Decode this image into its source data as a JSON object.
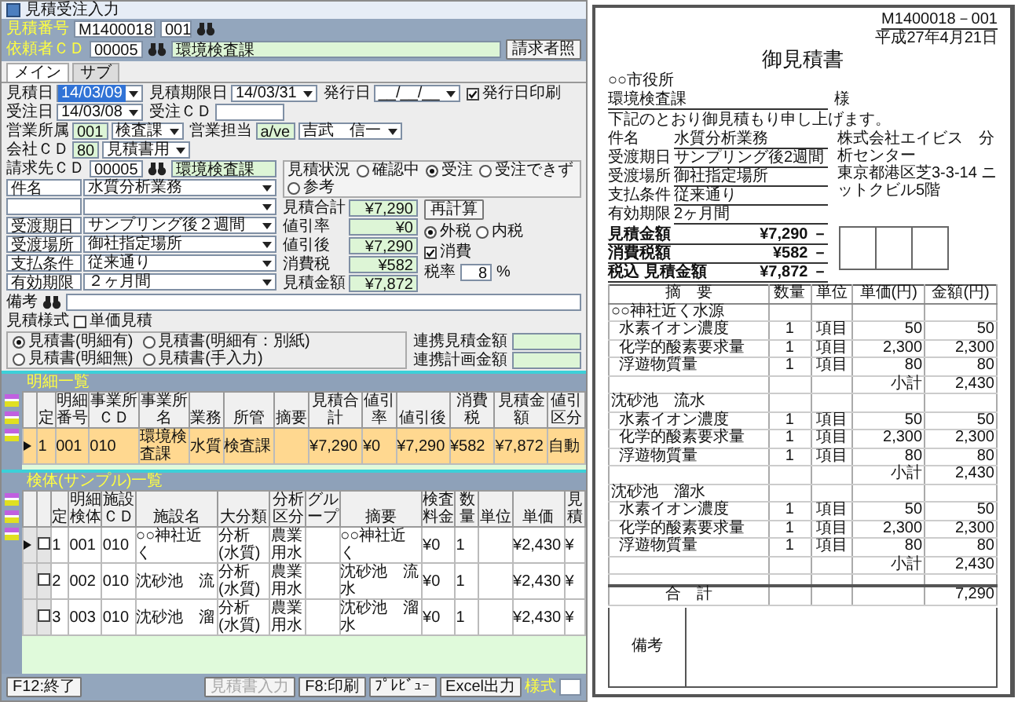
{
  "app": {
    "title": "見積受注入力"
  },
  "estimate_no": {
    "label": "見積番号",
    "value": "M1400018",
    "branch": "001"
  },
  "requester": {
    "label": "依頼者ＣＤ",
    "code": "00005",
    "name": "環境検査課",
    "button": "請求者照"
  },
  "tabs": [
    {
      "label": "メイン",
      "selected": true
    },
    {
      "label": "サブ",
      "selected": false
    }
  ],
  "date_row": [
    {
      "kind": "date",
      "label": "見積日",
      "value": "14/03/09",
      "highlighted": true
    },
    {
      "kind": "date",
      "label": "見積期限日",
      "value": "14/03/31",
      "highlighted": false
    },
    {
      "kind": "date",
      "label": "発行日",
      "value": "__/__/__",
      "highlighted": false
    },
    {
      "kind": "check",
      "label": "発行日印刷",
      "checked": true
    },
    {
      "kind": "date",
      "label": "受注日",
      "value": "14/03/08",
      "highlighted": false
    },
    {
      "kind": "text",
      "label": "受注ＣＤ"
    }
  ],
  "sales_row": [
    {
      "label": "営業所属",
      "code": "001",
      "name": "検査課"
    },
    {
      "label": "営業担当",
      "code": "a/ve",
      "name": "吉武　信一"
    },
    {
      "label": "会社ＣＤ",
      "code": "80",
      "name": "見積書用"
    }
  ],
  "billing": {
    "label": "請求先ＣＤ",
    "code": "00005",
    "name": "環境検査課"
  },
  "detail_fields": [
    {
      "kind": "field",
      "label": "件名",
      "value": "水質分析業務"
    },
    {
      "kind": "blank"
    },
    {
      "kind": "field",
      "label": "受渡期日",
      "value": "サンプリング後２週間"
    },
    {
      "kind": "field",
      "label": "受渡場所",
      "value": "御社指定場所"
    },
    {
      "kind": "field",
      "label": "支払条件",
      "value": "従来通り"
    },
    {
      "kind": "field",
      "label": "有効期限",
      "value": "２ヶ月間"
    }
  ],
  "status": {
    "label": "見積状況",
    "options": [
      {
        "label": "確認中",
        "selected": false
      },
      {
        "label": "受注",
        "selected": true
      },
      {
        "label": "受注できず",
        "selected": false
      },
      {
        "label": "参考",
        "selected": false
      }
    ]
  },
  "amounts": [
    {
      "label": "見積合計",
      "value": "¥7,290"
    },
    {
      "label": "値引率",
      "value": "¥0"
    },
    {
      "label": "値引後",
      "value": "¥7,290"
    },
    {
      "label": "消費税",
      "value": "¥582"
    },
    {
      "label": "見積金額",
      "value": "¥7,872"
    }
  ],
  "recalc_button": "再計算",
  "tax_mode": [
    {
      "label": "外税",
      "selected": true
    },
    {
      "label": "内税",
      "selected": false
    }
  ],
  "tax_check": {
    "label": "消費",
    "checked": true
  },
  "tax_rate": {
    "label": "税率",
    "value": "8",
    "unit": "%"
  },
  "remarks": {
    "label": "備考"
  },
  "format_check": {
    "label": "見積様式",
    "option": "単価見積",
    "checked": false
  },
  "format_options": [
    {
      "label": "見積書(明細有)",
      "selected": true
    },
    {
      "label": "見積書(明細有：別紙)",
      "selected": false
    },
    {
      "label": "見積書(明細無)",
      "selected": false
    },
    {
      "label": "見積書(手入力)",
      "selected": false
    }
  ],
  "linked": [
    {
      "label": "連携見積金額"
    },
    {
      "label": "連携計画金額"
    }
  ],
  "detail_table": {
    "title": "明細一覧",
    "columns": [
      "定",
      "明細番号",
      "事業所ＣＤ",
      "事業所名",
      "業務",
      "所管",
      "摘要",
      "見積合計",
      "値引率",
      "値引後",
      "消費税",
      "見積金額",
      "値引区分"
    ],
    "rows": [
      {
        "selected": true,
        "current": true,
        "cells": [
          "1",
          "001",
          "010",
          "環境検査課",
          "水質",
          "検査課",
          null,
          "¥7,290",
          "¥0",
          "¥7,290",
          "¥582",
          "¥7,872",
          "自動"
        ]
      }
    ]
  },
  "sample_table": {
    "title": "検体(サンプル)一覧",
    "columns": [
      "定",
      "明細検体",
      "施設ＣＤ",
      "施設名",
      "大分類",
      "分析区分",
      "グループ",
      "摘要",
      "検査料金",
      "数量",
      "単位",
      "単価",
      "見積"
    ],
    "rows": [
      {
        "current": true,
        "checked": false,
        "cells": [
          "1",
          "001",
          "010",
          "○○神社近く",
          "分析(水質)",
          "農業用水",
          null,
          "○○神社近く",
          "¥0",
          "1",
          null,
          "¥2,430",
          "¥"
        ]
      },
      {
        "current": false,
        "checked": false,
        "cells": [
          "2",
          "002",
          "010",
          "沈砂池　流",
          "分析(水質)",
          "農業用水",
          null,
          "沈砂池　流水",
          "¥0",
          "1",
          null,
          "¥2,430",
          "¥"
        ]
      },
      {
        "current": false,
        "checked": false,
        "cells": [
          "3",
          "003",
          "010",
          "沈砂池　溜",
          "分析(水質)",
          "農業用水",
          null,
          "沈砂池　溜水",
          "¥0",
          "1",
          null,
          "¥2,430",
          "¥"
        ]
      }
    ]
  },
  "exit_button": {
    "label": "F12:終了",
    "disabled": false
  },
  "buttons": [
    {
      "label": "見積書入力",
      "disabled": true
    },
    {
      "label": "F8:印刷",
      "disabled": false
    },
    {
      "label": "ﾌﾟﾚﾋﾞｭｰ",
      "disabled": false
    },
    {
      "label": "Excel出力",
      "disabled": false
    }
  ],
  "style_field": {
    "label": "様式"
  },
  "document": {
    "number": "M1400018－001",
    "date": "平成27年4月21日",
    "title": "御見積書",
    "addressee_org": "○○市役所",
    "addressee_dept": "環境検査課",
    "honorific": "様",
    "intro": "下記のとおり御見積もり申し上げます。",
    "subject_label": "件名",
    "subject": "水質分析業務",
    "company": "株式会社エイビス　分析センター",
    "address": "東京都港区芝3-3-14 ニットクビル5階",
    "terms": [
      {
        "label": "受渡期日",
        "value": "サンプリング後2週間"
      },
      {
        "label": "受渡場所",
        "value": "御社指定場所"
      },
      {
        "label": "支払条件",
        "value": "従来通り"
      },
      {
        "label": "有効期限",
        "value": "2ヶ月間"
      }
    ],
    "totals": [
      {
        "label": "見積金額",
        "value": "¥7,290 －"
      },
      {
        "label": "消費税額",
        "value": "¥582 －"
      },
      {
        "label": "税込 見積金額",
        "value": "¥7,872 －"
      }
    ],
    "columns": [
      "摘　要",
      "数量",
      "単位",
      "単価(円)",
      "金額(円)"
    ],
    "rows": [
      {
        "kind": "group",
        "name": "○○神社近く水源"
      },
      {
        "kind": "item",
        "name": "水素イオン濃度",
        "qty": "1",
        "unit": "項目",
        "price": "50",
        "amount": "50"
      },
      {
        "kind": "item",
        "name": "化学的酸素要求量",
        "qty": "1",
        "unit": "項目",
        "price": "2,300",
        "amount": "2,300"
      },
      {
        "kind": "item",
        "name": "浮遊物質量",
        "qty": "1",
        "unit": "項目",
        "price": "80",
        "amount": "80"
      },
      {
        "kind": "subtotal",
        "label": "小計",
        "amount": "2,430"
      },
      {
        "kind": "group",
        "name": "沈砂池　流水"
      },
      {
        "kind": "item",
        "name": "水素イオン濃度",
        "qty": "1",
        "unit": "項目",
        "price": "50",
        "amount": "50"
      },
      {
        "kind": "item",
        "name": "化学的酸素要求量",
        "qty": "1",
        "unit": "項目",
        "price": "2,300",
        "amount": "2,300"
      },
      {
        "kind": "item",
        "name": "浮遊物質量",
        "qty": "1",
        "unit": "項目",
        "price": "80",
        "amount": "80"
      },
      {
        "kind": "subtotal",
        "label": "小計",
        "amount": "2,430"
      },
      {
        "kind": "group",
        "name": "沈砂池　溜水"
      },
      {
        "kind": "item",
        "name": "水素イオン濃度",
        "qty": "1",
        "unit": "項目",
        "price": "50",
        "amount": "50"
      },
      {
        "kind": "item",
        "name": "化学的酸素要求量",
        "qty": "1",
        "unit": "項目",
        "price": "2,300",
        "amount": "2,300"
      },
      {
        "kind": "item",
        "name": "浮遊物質量",
        "qty": "1",
        "unit": "項目",
        "price": "80",
        "amount": "80"
      },
      {
        "kind": "subtotal",
        "label": "小計",
        "amount": "2,430"
      }
    ],
    "total": {
      "label": "合　計",
      "amount": "7,290"
    },
    "remarks_label": "備考"
  }
}
